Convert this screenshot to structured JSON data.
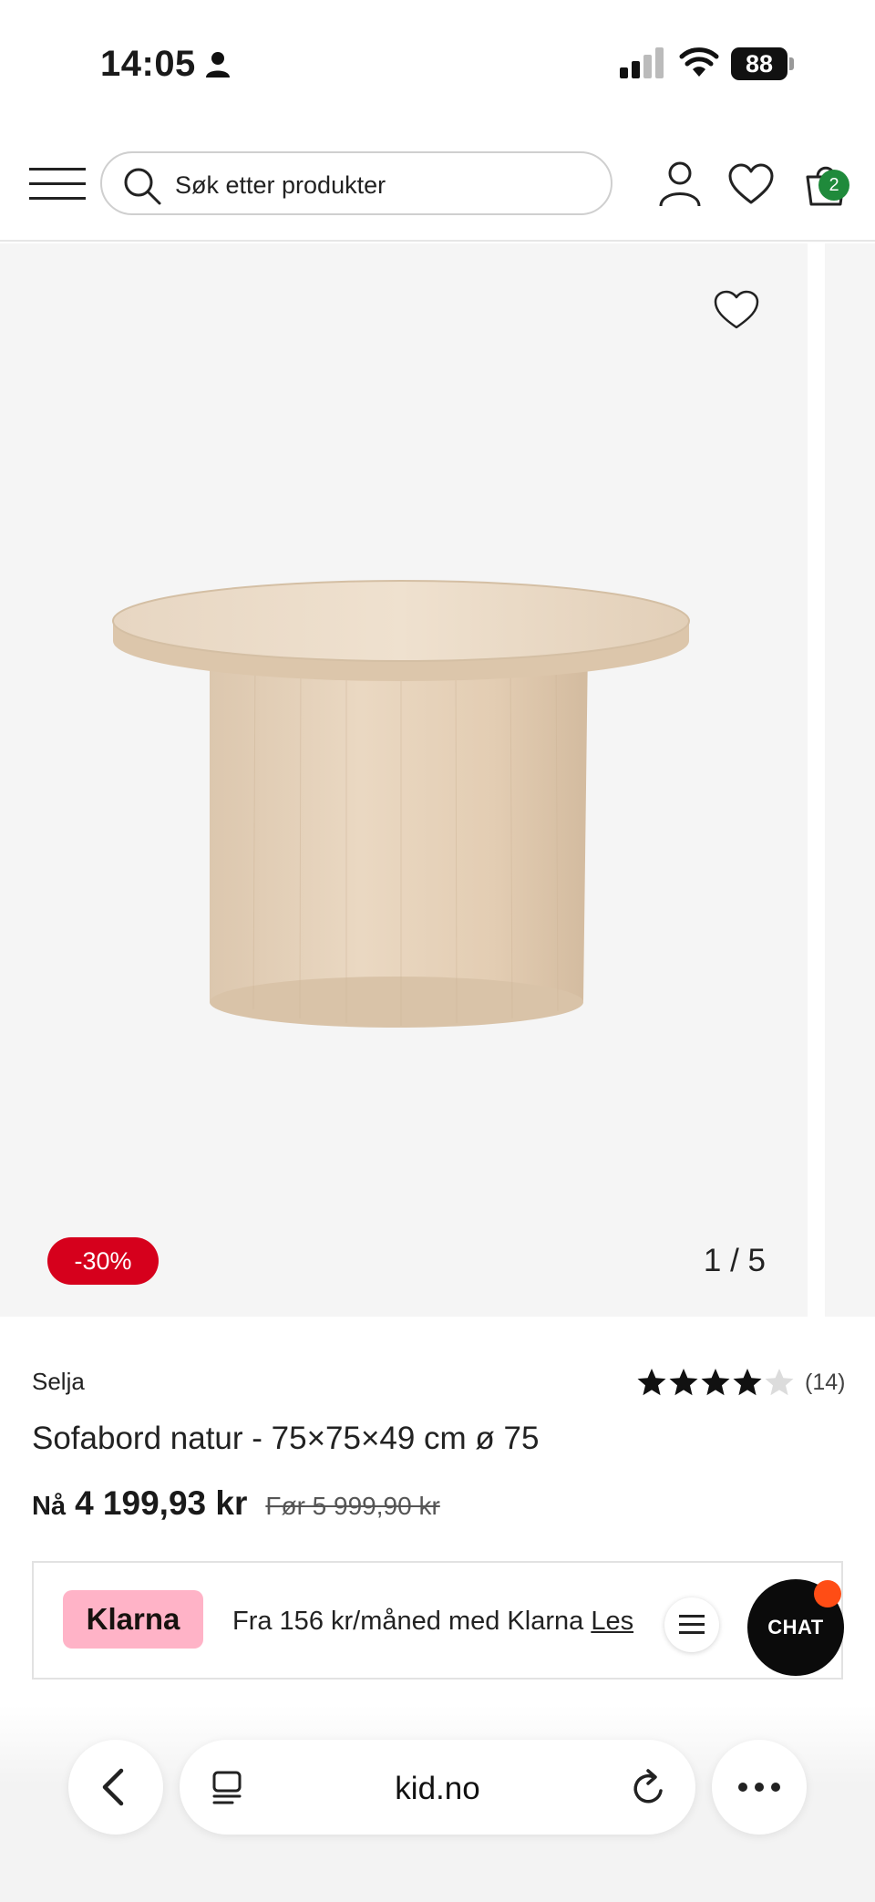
{
  "status_bar": {
    "time": "14:05",
    "battery": "88"
  },
  "header": {
    "search_placeholder": "Søk etter produkter",
    "cart_count": "2"
  },
  "gallery": {
    "discount": "-30%",
    "counter": "1 / 5"
  },
  "product": {
    "brand": "Selja",
    "rating_value": 4,
    "rating_max": 5,
    "rating_count": "(14)",
    "title": "Sofabord natur - 75×75×49 cm ø 75",
    "price_now_label": "Nå",
    "price_now": "4 199,93 kr",
    "price_before": "Før 5 999,90 kr"
  },
  "klarna": {
    "logo": "Klarna",
    "text": "Fra 156 kr/måned med Klarna",
    "link": "Les"
  },
  "chat": {
    "label": "CHAT"
  },
  "browser": {
    "url": "kid.no"
  },
  "colors": {
    "discount": "#d6001c",
    "cart_badge": "#1f8a3b",
    "klarna_pink": "#ffb3c7",
    "chat_notification": "#ff4d15"
  },
  "icons": [
    "person-icon",
    "signal-icon",
    "wifi-icon",
    "battery-icon",
    "menu-icon",
    "search-icon",
    "account-icon",
    "heart-icon",
    "cart-icon",
    "star-icon",
    "list-icon",
    "chevron-left-icon",
    "tabs-icon",
    "reload-icon",
    "more-icon"
  ]
}
